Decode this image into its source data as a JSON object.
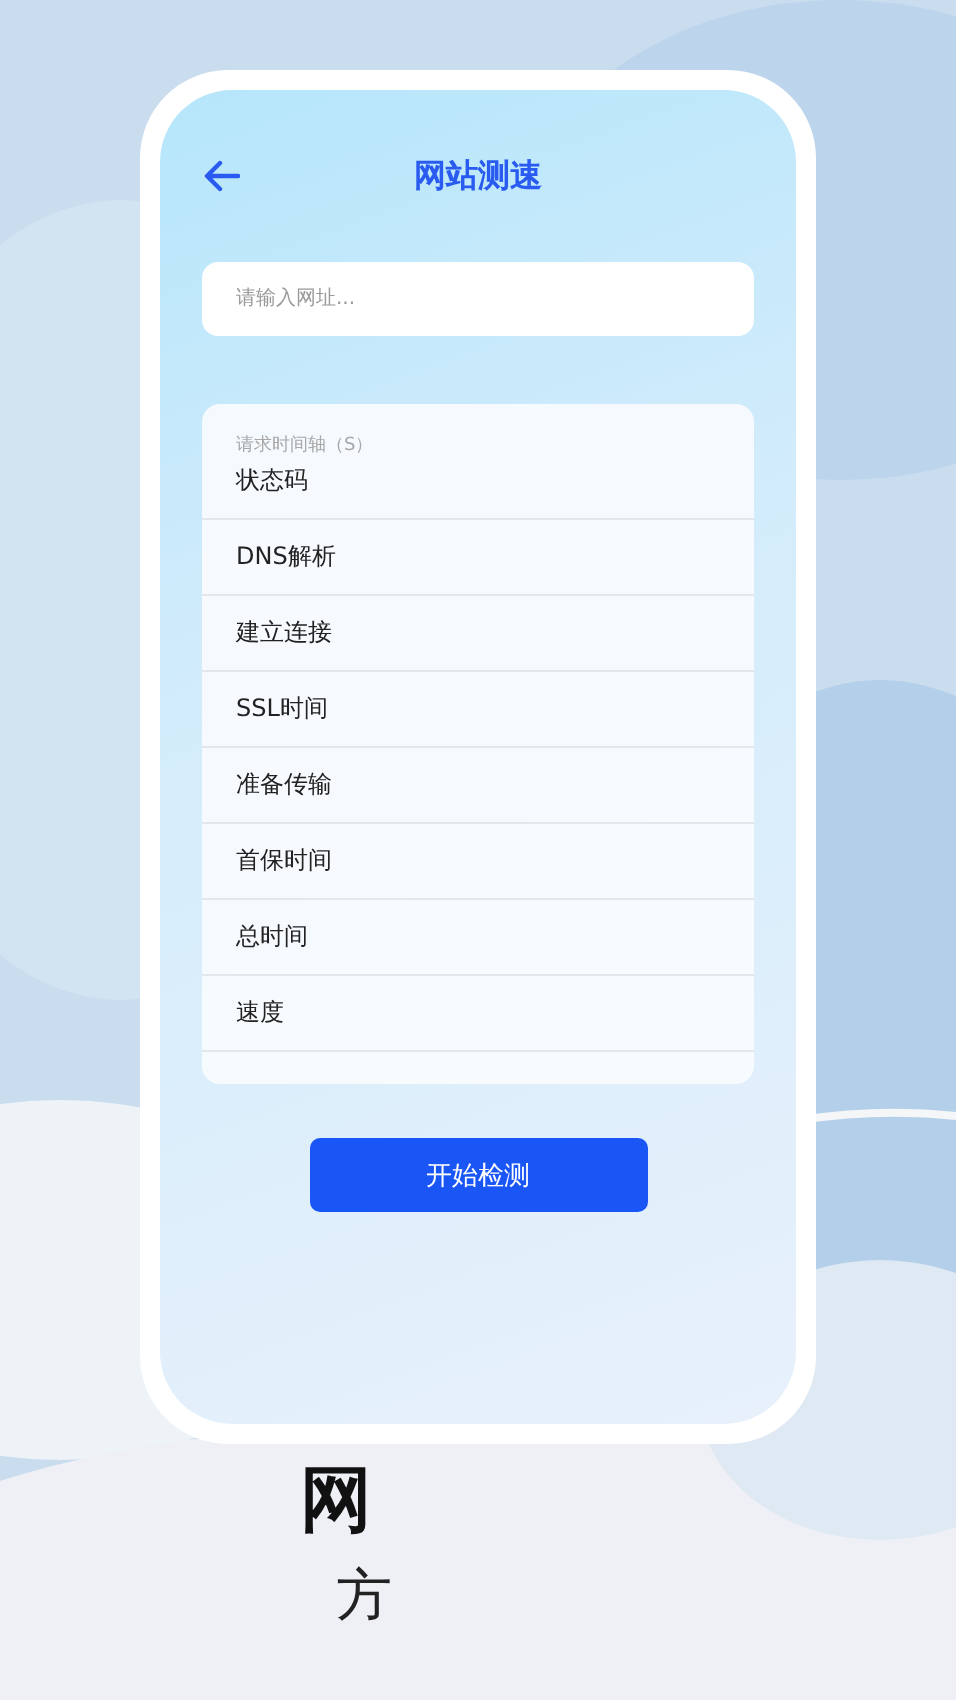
{
  "header": {
    "title": "网站测速"
  },
  "url_field": {
    "placeholder": "请输入网址..."
  },
  "results": {
    "caption": "请求时间轴（S）",
    "rows": [
      {
        "label": "状态码"
      },
      {
        "label": "DNS解析"
      },
      {
        "label": "建立连接"
      },
      {
        "label": "SSL时间"
      },
      {
        "label": "准备传输"
      },
      {
        "label": "首保时间"
      },
      {
        "label": "总时间"
      },
      {
        "label": "速度"
      }
    ]
  },
  "start_button": {
    "label": "开始检测"
  },
  "promo": {
    "headline": "网",
    "subline": "方"
  }
}
